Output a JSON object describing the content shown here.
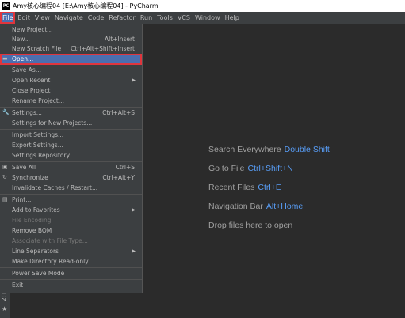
{
  "window": {
    "title": "Amy核心编程04 [E:\\Amy核心编程04] - PyCharm",
    "app_icon": "PC"
  },
  "menubar": [
    "File",
    "Edit",
    "View",
    "Navigate",
    "Code",
    "Refactor",
    "Run",
    "Tools",
    "VCS",
    "Window",
    "Help"
  ],
  "file_menu": {
    "new_project": "New Project...",
    "new": "New...",
    "new_sc": "Alt+Insert",
    "new_scratch": "New Scratch File",
    "new_scratch_sc": "Ctrl+Alt+Shift+Insert",
    "open": "Open...",
    "save_as": "Save As...",
    "open_recent": "Open Recent",
    "close_project": "Close Project",
    "rename_project": "Rename Project...",
    "settings": "Settings...",
    "settings_sc": "Ctrl+Alt+S",
    "settings_new": "Settings for New Projects...",
    "import_settings": "Import Settings...",
    "export_settings": "Export Settings...",
    "settings_repo": "Settings Repository...",
    "save_all": "Save All",
    "save_all_sc": "Ctrl+S",
    "synchronize": "Synchronize",
    "synchronize_sc": "Ctrl+Alt+Y",
    "invalidate": "Invalidate Caches / Restart...",
    "print": "Print...",
    "add_favorites": "Add to Favorites",
    "file_encoding": "File Encoding",
    "remove_bom": "Remove BOM",
    "associate": "Associate with File Type...",
    "line_sep": "Line Separators",
    "make_readonly": "Make Directory Read-only",
    "power_save": "Power Save Mode",
    "exit": "Exit"
  },
  "sidebar": {
    "favorites_label": "2: Fav"
  },
  "welcome": {
    "search_label": "Search Everywhere",
    "search_key": "Double Shift",
    "goto_label": "Go to File",
    "goto_key": "Ctrl+Shift+N",
    "recent_label": "Recent Files",
    "recent_key": "Ctrl+E",
    "nav_label": "Navigation Bar",
    "nav_key": "Alt+Home",
    "drop_label": "Drop files here to open"
  },
  "colors": {
    "accent": "#589df6",
    "selection": "#4b6eaf",
    "highlight_border": "#e0353d"
  }
}
